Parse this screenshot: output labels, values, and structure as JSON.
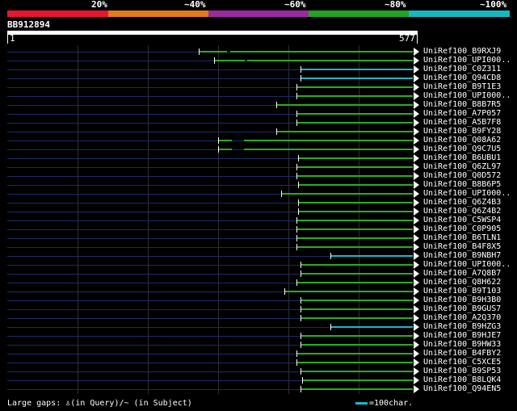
{
  "header": {
    "percent_labels": [
      "20%",
      "~40%",
      "~60%",
      "~80%",
      "~100%"
    ],
    "identity_colors": [
      "#e8162f",
      "#e07a1c",
      "#9a2a9e",
      "#23a323",
      "#17b7c2"
    ]
  },
  "query": {
    "name": "BB912894",
    "start": "1",
    "end": "577",
    "length": 577
  },
  "colors": {
    "hit_green": "#2aad1d",
    "hit_cyan": "#19b8cc",
    "track": "#1c2a66",
    "gap": "#1c2a66",
    "arrow": "#ffffff"
  },
  "hits": [
    {
      "label": "UniRef100_B9RXJ9",
      "segments": [
        {
          "s": 273,
          "e": 313,
          "c": "green"
        },
        {
          "s": 318,
          "e": 577,
          "c": "green"
        }
      ],
      "ticks": [
        273
      ]
    },
    {
      "label": "UniRef100_UPI000..",
      "segments": [
        {
          "s": 295,
          "e": 338,
          "c": "green"
        },
        {
          "s": 342,
          "e": 577,
          "c": "green"
        }
      ],
      "ticks": [
        295
      ]
    },
    {
      "label": "UniRef100_C0Z311",
      "segments": [
        {
          "s": 418,
          "e": 577,
          "c": "cyan"
        }
      ],
      "ticks": [
        418
      ]
    },
    {
      "label": "UniRef100_Q94CD8",
      "segments": [
        {
          "s": 418,
          "e": 577,
          "c": "cyan"
        }
      ],
      "ticks": [
        418
      ]
    },
    {
      "label": "UniRef100_B9T1E3",
      "segments": [
        {
          "s": 412,
          "e": 577,
          "c": "green"
        }
      ],
      "ticks": [
        412
      ]
    },
    {
      "label": "UniRef100_UPI000..",
      "segments": [
        {
          "s": 412,
          "e": 577,
          "c": "green"
        }
      ],
      "ticks": [
        412
      ]
    },
    {
      "label": "UniRef100_B8B7R5",
      "segments": [
        {
          "s": 383,
          "e": 577,
          "c": "green"
        }
      ],
      "ticks": [
        383
      ]
    },
    {
      "label": "UniRef100_A7P057",
      "segments": [
        {
          "s": 412,
          "e": 577,
          "c": "green"
        }
      ],
      "ticks": [
        412
      ]
    },
    {
      "label": "UniRef100_A5B7F8",
      "segments": [
        {
          "s": 412,
          "e": 577,
          "c": "green"
        }
      ],
      "ticks": [
        412
      ]
    },
    {
      "label": "UniRef100_B9FY28",
      "segments": [
        {
          "s": 383,
          "e": 577,
          "c": "green"
        }
      ],
      "ticks": [
        383
      ]
    },
    {
      "label": "UniRef100_Q08A62",
      "segments": [
        {
          "s": 300,
          "e": 320,
          "c": "green"
        },
        {
          "s": 337,
          "e": 577,
          "c": "green"
        }
      ],
      "ticks": [
        300
      ]
    },
    {
      "label": "UniRef100_Q9C7U5",
      "segments": [
        {
          "s": 300,
          "e": 320,
          "c": "green"
        },
        {
          "s": 337,
          "e": 577,
          "c": "green"
        }
      ],
      "ticks": [
        300
      ]
    },
    {
      "label": "UniRef100_B6UBU1",
      "segments": [
        {
          "s": 414,
          "e": 577,
          "c": "green"
        }
      ],
      "ticks": [
        414
      ]
    },
    {
      "label": "UniRef100_Q6ZL97",
      "segments": [
        {
          "s": 412,
          "e": 577,
          "c": "green"
        }
      ],
      "ticks": [
        412
      ]
    },
    {
      "label": "UniRef100_Q0D572",
      "segments": [
        {
          "s": 412,
          "e": 577,
          "c": "green"
        }
      ],
      "ticks": [
        412
      ]
    },
    {
      "label": "UniRef100_B8B6P5",
      "segments": [
        {
          "s": 414,
          "e": 577,
          "c": "green"
        }
      ],
      "ticks": [
        414
      ]
    },
    {
      "label": "UniRef100_UPI000..",
      "segments": [
        {
          "s": 390,
          "e": 577,
          "c": "green"
        }
      ],
      "ticks": [
        390
      ]
    },
    {
      "label": "UniRef100_Q6Z4B3",
      "segments": [
        {
          "s": 414,
          "e": 577,
          "c": "green"
        }
      ],
      "ticks": [
        414
      ]
    },
    {
      "label": "UniRef100_Q6Z4B2",
      "segments": [
        {
          "s": 414,
          "e": 577,
          "c": "green"
        }
      ],
      "ticks": [
        414
      ]
    },
    {
      "label": "UniRef100_C5WSP4",
      "segments": [
        {
          "s": 412,
          "e": 577,
          "c": "green"
        }
      ],
      "ticks": [
        412
      ]
    },
    {
      "label": "UniRef100_C0P905",
      "segments": [
        {
          "s": 412,
          "e": 577,
          "c": "green"
        }
      ],
      "ticks": [
        412
      ]
    },
    {
      "label": "UniRef100_B6TLN1",
      "segments": [
        {
          "s": 412,
          "e": 577,
          "c": "green"
        }
      ],
      "ticks": [
        412
      ]
    },
    {
      "label": "UniRef100_B4F8X5",
      "segments": [
        {
          "s": 412,
          "e": 577,
          "c": "green"
        }
      ],
      "ticks": [
        412
      ]
    },
    {
      "label": "UniRef100_B9NBH7",
      "segments": [
        {
          "s": 460,
          "e": 577,
          "c": "cyan"
        }
      ],
      "ticks": [
        460
      ]
    },
    {
      "label": "UniRef100_UPI000..",
      "segments": [
        {
          "s": 418,
          "e": 577,
          "c": "green"
        }
      ],
      "ticks": [
        418
      ]
    },
    {
      "label": "UniRef100_A7Q8B7",
      "segments": [
        {
          "s": 418,
          "e": 577,
          "c": "green"
        }
      ],
      "ticks": [
        418
      ]
    },
    {
      "label": "UniRef100_Q8H622",
      "segments": [
        {
          "s": 412,
          "e": 577,
          "c": "green"
        }
      ],
      "ticks": [
        412
      ]
    },
    {
      "label": "UniRef100_B9T103",
      "segments": [
        {
          "s": 395,
          "e": 577,
          "c": "green"
        }
      ],
      "ticks": [
        395
      ]
    },
    {
      "label": "UniRef100_B9H3B0",
      "segments": [
        {
          "s": 418,
          "e": 577,
          "c": "green"
        }
      ],
      "ticks": [
        418
      ]
    },
    {
      "label": "UniRef100_B9GUS7",
      "segments": [
        {
          "s": 418,
          "e": 577,
          "c": "green"
        }
      ],
      "ticks": [
        418
      ]
    },
    {
      "label": "UniRef100_A2Q370",
      "segments": [
        {
          "s": 418,
          "e": 577,
          "c": "green"
        }
      ],
      "ticks": [
        418
      ]
    },
    {
      "label": "UniRef100_B9HZG3",
      "segments": [
        {
          "s": 460,
          "e": 577,
          "c": "cyan"
        }
      ],
      "ticks": [
        460
      ]
    },
    {
      "label": "UniRef100_B9HJE7",
      "segments": [
        {
          "s": 418,
          "e": 577,
          "c": "green"
        }
      ],
      "ticks": [
        418
      ]
    },
    {
      "label": "UniRef100_B9HW33",
      "segments": [
        {
          "s": 418,
          "e": 577,
          "c": "green"
        }
      ],
      "ticks": [
        418
      ]
    },
    {
      "label": "UniRef100_B4FBY2",
      "segments": [
        {
          "s": 412,
          "e": 577,
          "c": "green"
        }
      ],
      "ticks": [
        412
      ]
    },
    {
      "label": "UniRef100_C5XCE5",
      "segments": [
        {
          "s": 412,
          "e": 577,
          "c": "green"
        }
      ],
      "ticks": [
        412
      ]
    },
    {
      "label": "UniRef100_B9SP53",
      "segments": [
        {
          "s": 418,
          "e": 577,
          "c": "green"
        }
      ],
      "ticks": [
        418
      ]
    },
    {
      "label": "UniRef100_B8LQK4",
      "segments": [
        {
          "s": 420,
          "e": 577,
          "c": "green"
        }
      ],
      "ticks": [
        420
      ]
    },
    {
      "label": "UniRef100_Q94EN5",
      "segments": [
        {
          "s": 418,
          "e": 577,
          "c": "green"
        }
      ],
      "ticks": [
        418
      ]
    }
  ],
  "footer": {
    "gaps_text": "Large gaps: ♙(in Query)/~ (in Subject)",
    "legend_text": "=100char."
  }
}
